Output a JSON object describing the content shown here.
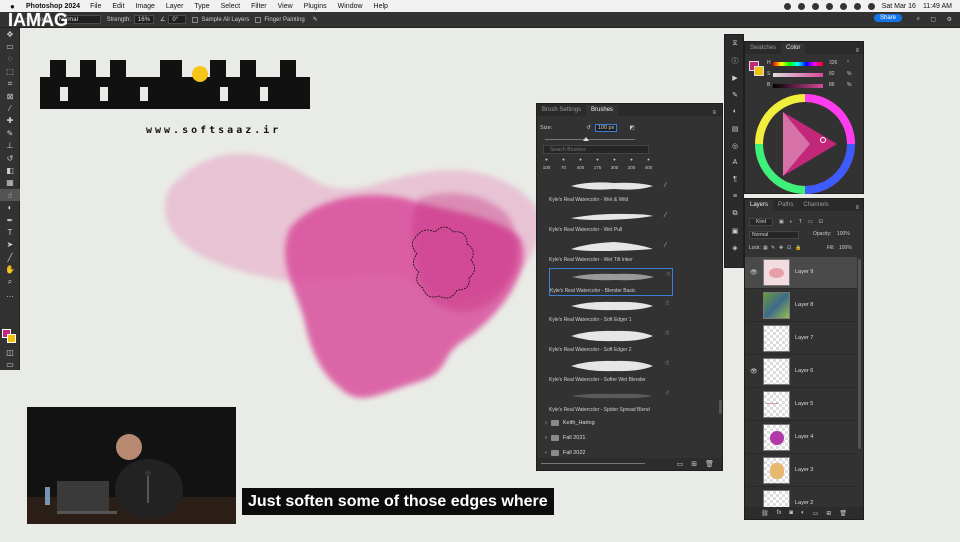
{
  "menubar": {
    "app": "Photoshop 2024",
    "items": [
      "File",
      "Edit",
      "Image",
      "Layer",
      "Type",
      "Select",
      "Filter",
      "View",
      "Plugins",
      "Window",
      "Help"
    ],
    "datetime": "Sat Mar 16",
    "time": "11:49 AM"
  },
  "options": {
    "mode_label": "Mode:",
    "mode_value": "Normal",
    "strength_label": "Strength:",
    "strength_value": "16%",
    "angle_value": "0°",
    "sample_all_layers": "Sample All Layers",
    "finger_painting": "Finger Painting",
    "share": "Share"
  },
  "brand": {
    "line1": "IAMAG",
    "line2": "MA"
  },
  "watermark": {
    "logo_text": "سافت ساز",
    "url": "www.softsaaz.ir"
  },
  "colors": {
    "foreground": "#c2277a",
    "background": "#f0c20a",
    "pink": "#d9489a"
  },
  "brushes_panel": {
    "tabs": [
      "Brush Settings",
      "Brushes"
    ],
    "size_label": "Size:",
    "size_value": "100 px",
    "search_placeholder": "Search Brushes",
    "presets": [
      "100",
      "70",
      "400",
      "175",
      "300",
      "200",
      "400"
    ],
    "items": [
      "Kyle's Real Watercolor - Wet & Wild",
      "Kyle's Real Watercolor - Wet Pull",
      "Kyle's Real Watercolor - Wet Tilt Inker",
      "Kyle's Real Watercolor - Blender Basic",
      "Kyle's Real Watercolor - Soft Edger 1",
      "Kyle's Real Watercolor - Soft Edger 2",
      "Kyle's Real Watercolor - Softer Wet Blender",
      "Kyle's Real Watercolor - Spider Spread Blend"
    ],
    "selected": "Kyle's Real Watercolor - Blender Basic",
    "folders": [
      "Keith_Haring",
      "Fall 2021",
      "Fall 2022"
    ]
  },
  "color_panel": {
    "tabs": [
      "Swatches",
      "Color"
    ],
    "h_label": "H",
    "h_value": "326",
    "s_label": "S",
    "s_value": "82",
    "b_label": "B",
    "b_value": "86",
    "unit_deg": "°",
    "unit_pct": "%"
  },
  "layers_panel": {
    "tabs": [
      "Layers",
      "Paths",
      "Channels"
    ],
    "kind": "Kind",
    "blend": "Normal",
    "opacity_label": "Opacity:",
    "opacity_value": "100%",
    "lock_label": "Lock:",
    "fill_label": "Fill:",
    "fill_value": "100%",
    "layers": [
      {
        "name": "Layer 9",
        "visible": true,
        "active": true
      },
      {
        "name": "Layer 8",
        "visible": false,
        "active": false
      },
      {
        "name": "Layer 7",
        "visible": false,
        "active": false
      },
      {
        "name": "Layer 6",
        "visible": true,
        "active": false
      },
      {
        "name": "Layer 5",
        "visible": false,
        "active": false
      },
      {
        "name": "Layer 4",
        "visible": false,
        "active": false
      },
      {
        "name": "Layer 3",
        "visible": false,
        "active": false
      },
      {
        "name": "Layer 2",
        "visible": false,
        "active": false
      }
    ]
  },
  "caption": "Just soften some of those edges where"
}
